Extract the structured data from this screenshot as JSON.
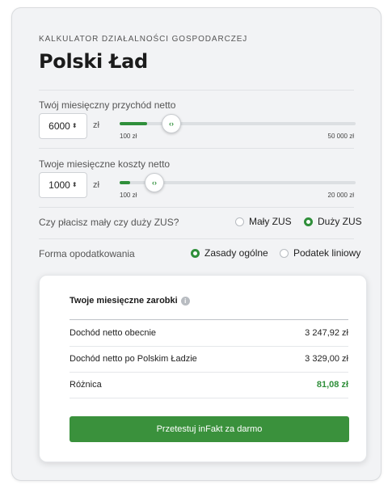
{
  "header": {
    "eyebrow": "KALKULATOR DZIAŁALNOŚCI GOSPODARCZEJ",
    "title": "Polski Ład"
  },
  "income": {
    "label": "Twój miesięczny przychód netto",
    "value": "6000",
    "unit": "zł",
    "min_label": "100 zł",
    "max_label": "50 000 zł",
    "slider_fraction": 0.118
  },
  "costs": {
    "label": "Twoje miesięczne koszty netto",
    "value": "1000",
    "unit": "zł",
    "min_label": "100 zł",
    "max_label": "20 000 zł",
    "slider_fraction": 0.045
  },
  "zus": {
    "label": "Czy płacisz mały czy duży ZUS?",
    "options": [
      {
        "label": "Mały ZUS",
        "selected": false
      },
      {
        "label": "Duży ZUS",
        "selected": true
      }
    ]
  },
  "tax": {
    "label": "Forma opodatkowania",
    "options": [
      {
        "label": "Zasady ogólne",
        "selected": true
      },
      {
        "label": "Podatek liniowy",
        "selected": false
      }
    ]
  },
  "result": {
    "title": "Twoje miesięczne zarobki",
    "info_icon": "info-icon",
    "rows": [
      {
        "label": "Dochód netto obecnie",
        "value": "3 247,92 zł"
      },
      {
        "label": "Dochód netto po Polskim Ładzie",
        "value": "3 329,00 zł"
      },
      {
        "label": "Różnica",
        "value": "81,08 zł"
      }
    ],
    "cta_label": "Przetestuj inFakt za darmo"
  },
  "colors": {
    "accent": "#2f8f3a",
    "card_bg": "#f2f3f5"
  }
}
